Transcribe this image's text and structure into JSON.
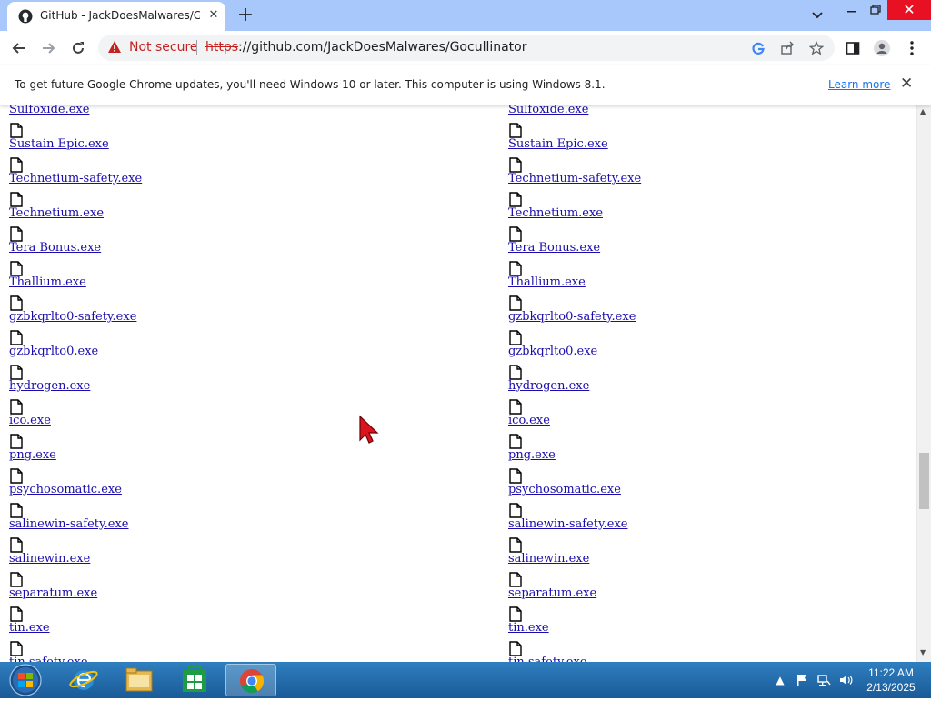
{
  "browser": {
    "tab_title": "GitHub - JackDoesMalwares/Goc",
    "security_label": "Not secure",
    "url_scheme": "https",
    "url_rest": "://github.com/JackDoesMalwares/Gocullinator"
  },
  "infobar": {
    "message": "To get future Google Chrome updates, you'll need Windows 10 or later. This computer is using Windows 8.1.",
    "link_label": "Learn more"
  },
  "files": [
    "Sulfoxide.exe",
    "Sustain Epic.exe",
    "Technetium-safety.exe",
    "Technetium.exe",
    "Tera Bonus.exe",
    "Thallium.exe",
    "gzbkqrlto0-safety.exe",
    "gzbkqrlto0.exe",
    "hydrogen.exe",
    "ico.exe",
    "png.exe",
    "psychosomatic.exe",
    "salinewin-safety.exe",
    "salinewin.exe",
    "separatum.exe",
    "tin.exe",
    "tin.safety.exe"
  ],
  "taskbar": {
    "time": "11:22 AM",
    "date": "2/13/2025"
  },
  "icons": {
    "file": "file-icon",
    "tab_favicon": "github-favicon-icon",
    "warning": "warning-triangle-icon"
  },
  "colors": {
    "link": "#1a0dab",
    "tabstrip": "#a8c7fa",
    "not_secure": "#c5221f",
    "taskbar": "#1f6aad"
  }
}
